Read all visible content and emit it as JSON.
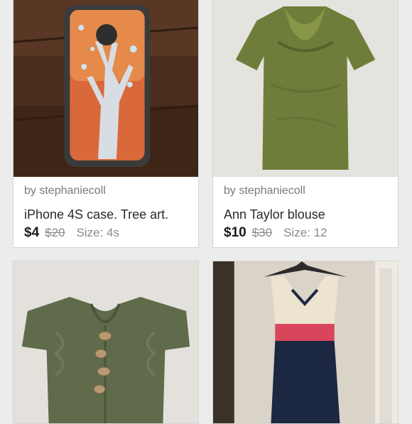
{
  "listings": [
    {
      "seller": "by stephaniecoll",
      "title": "iPhone 4S case. Tree art.",
      "price": "$4",
      "original_price": "$20",
      "size": "Size: 4s",
      "image": "phone-case-photo"
    },
    {
      "seller": "by stephaniecoll",
      "title": "Ann Taylor blouse",
      "price": "$10",
      "original_price": "$30",
      "size": "Size: 12",
      "image": "green-blouse-photo"
    },
    {
      "image": "green-cardigan-photo"
    },
    {
      "image": "dress-on-hanger-photo"
    }
  ],
  "colors": {
    "background": "#ececec",
    "card": "#ffffff",
    "seller_text": "#7a7a7a",
    "price_text": "#1a1a1a",
    "strike_text": "#8a8a8a"
  }
}
